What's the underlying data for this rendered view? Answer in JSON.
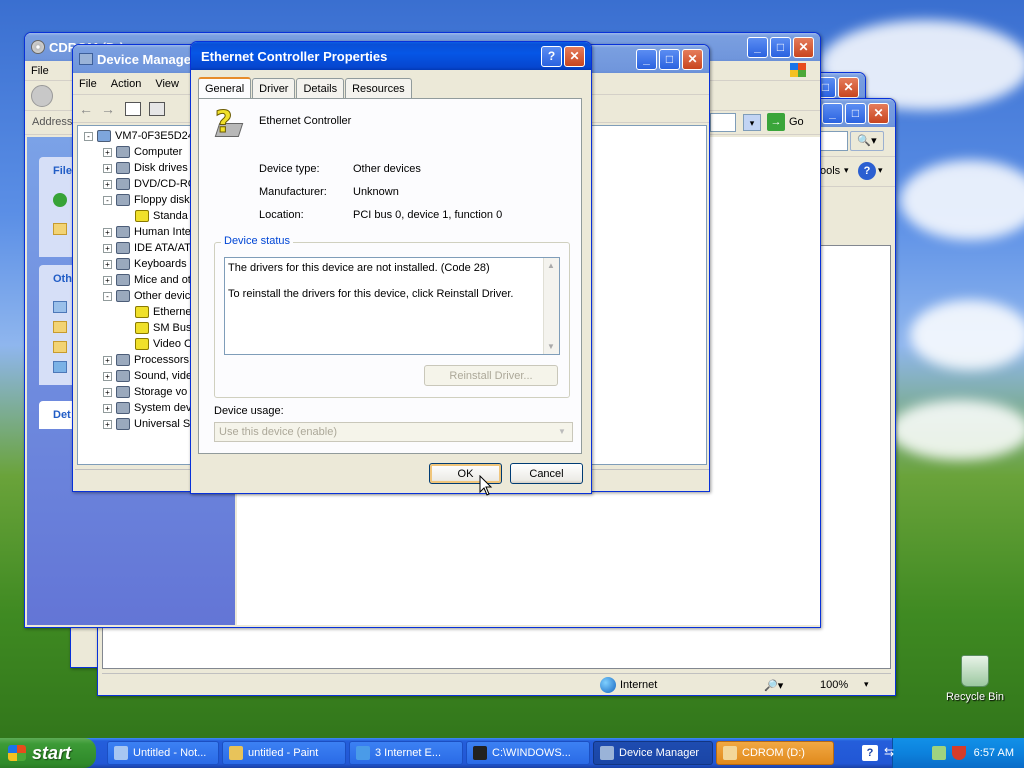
{
  "desktop": {
    "recycle_bin_label": "Recycle Bin"
  },
  "cdrom_window": {
    "title": "CDROM (D:)",
    "menu_file": "File",
    "address_label": "Address",
    "panel_file": "File",
    "panel_other": "Oth",
    "panel_details": "Det"
  },
  "ie_window": {
    "go_label": "Go",
    "tools_label": "ools",
    "status_zone": "Internet",
    "zoom": "100%"
  },
  "device_manager": {
    "title": "Device Manager",
    "menu": [
      "File",
      "Action",
      "View"
    ],
    "tree": [
      {
        "label": "VM7-0F3E5D24",
        "level": 0,
        "exp": "-"
      },
      {
        "label": "Computer",
        "level": 1,
        "exp": "+"
      },
      {
        "label": "Disk drives",
        "level": 1,
        "exp": "+"
      },
      {
        "label": "DVD/CD-RO",
        "level": 1,
        "exp": "+"
      },
      {
        "label": "Floppy disk",
        "level": 1,
        "exp": "-"
      },
      {
        "label": "Standa",
        "level": 2,
        "exp": ""
      },
      {
        "label": "Human Inte",
        "level": 1,
        "exp": "+"
      },
      {
        "label": "IDE ATA/AT",
        "level": 1,
        "exp": "+"
      },
      {
        "label": "Keyboards",
        "level": 1,
        "exp": "+"
      },
      {
        "label": "Mice and ot",
        "level": 1,
        "exp": "+"
      },
      {
        "label": "Other devic",
        "level": 1,
        "exp": "-"
      },
      {
        "label": "Etherne",
        "level": 2,
        "exp": ""
      },
      {
        "label": "SM Bus",
        "level": 2,
        "exp": ""
      },
      {
        "label": "Video C",
        "level": 2,
        "exp": ""
      },
      {
        "label": "Processors",
        "level": 1,
        "exp": "+"
      },
      {
        "label": "Sound, vide",
        "level": 1,
        "exp": "+"
      },
      {
        "label": "Storage vo",
        "level": 1,
        "exp": "+"
      },
      {
        "label": "System dev",
        "level": 1,
        "exp": "+"
      },
      {
        "label": "Universal S",
        "level": 1,
        "exp": "+"
      }
    ]
  },
  "dialog": {
    "title": "Ethernet Controller Properties",
    "tabs": [
      "General",
      "Driver",
      "Details",
      "Resources"
    ],
    "device_name": "Ethernet Controller",
    "labels": {
      "type": "Device type:",
      "manufacturer": "Manufacturer:",
      "location": "Location:"
    },
    "values": {
      "type": "Other devices",
      "manufacturer": "Unknown",
      "location": "PCI bus 0, device 1, function 0"
    },
    "status_group": "Device status",
    "status_line1": "The drivers for this device are not installed. (Code 28)",
    "status_line2": "To reinstall the drivers for this device, click Reinstall Driver.",
    "reinstall_label": "Reinstall Driver...",
    "usage_label": "Device usage:",
    "usage_value": "Use this device (enable)",
    "ok_label": "OK",
    "cancel_label": "Cancel"
  },
  "taskbar": {
    "start_label": "start",
    "tasks": [
      {
        "label": "Untitled - Not...",
        "icon_color": "#a7c6f2"
      },
      {
        "label": "untitled - Paint",
        "icon_color": "#e8c35a"
      },
      {
        "label": "3 Internet E...",
        "icon_color": "#4a9be8"
      },
      {
        "label": "C:\\WINDOWS...",
        "icon_color": "#222222"
      },
      {
        "label": "Device Manager",
        "icon_color": "#9ab3d8"
      },
      {
        "label": "CDROM (D:)",
        "icon_color": "#f3d79a"
      }
    ],
    "clock": "6:57 AM"
  }
}
